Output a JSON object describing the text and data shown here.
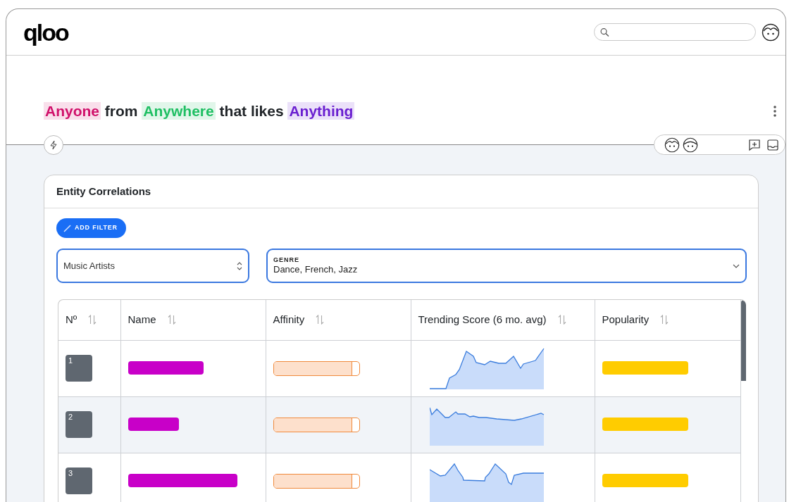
{
  "header": {
    "brand": "qloo"
  },
  "title": [
    {
      "text": "Anyone",
      "color": "#d0106a"
    },
    {
      "text": " from "
    },
    {
      "text": "Anywhere",
      "color": "#1fbf63"
    },
    {
      "text": " that likes "
    },
    {
      "text": "Anything",
      "color": "#6a1fd0"
    }
  ],
  "card": {
    "title": "Entity Correlations",
    "add_filter": "ADD FILTER",
    "type_select": {
      "value": "Music Artists"
    },
    "genre_select": {
      "label": "GENRE",
      "value": "Dance, French, Jazz"
    },
    "table": {
      "columns": [
        "Nº",
        "Name",
        "Affinity",
        "Trending Score (6 mo. avg)",
        "Popularity"
      ],
      "rows": [
        {
          "rank": "1",
          "selected": false,
          "affinity": {
            "level": 0.92
          }
        },
        {
          "rank": "2",
          "selected": true,
          "affinity": {
            "level": 0.92
          }
        },
        {
          "rank": "3",
          "selected": false,
          "affinity": {
            "level": 0.92
          }
        }
      ]
    }
  }
}
